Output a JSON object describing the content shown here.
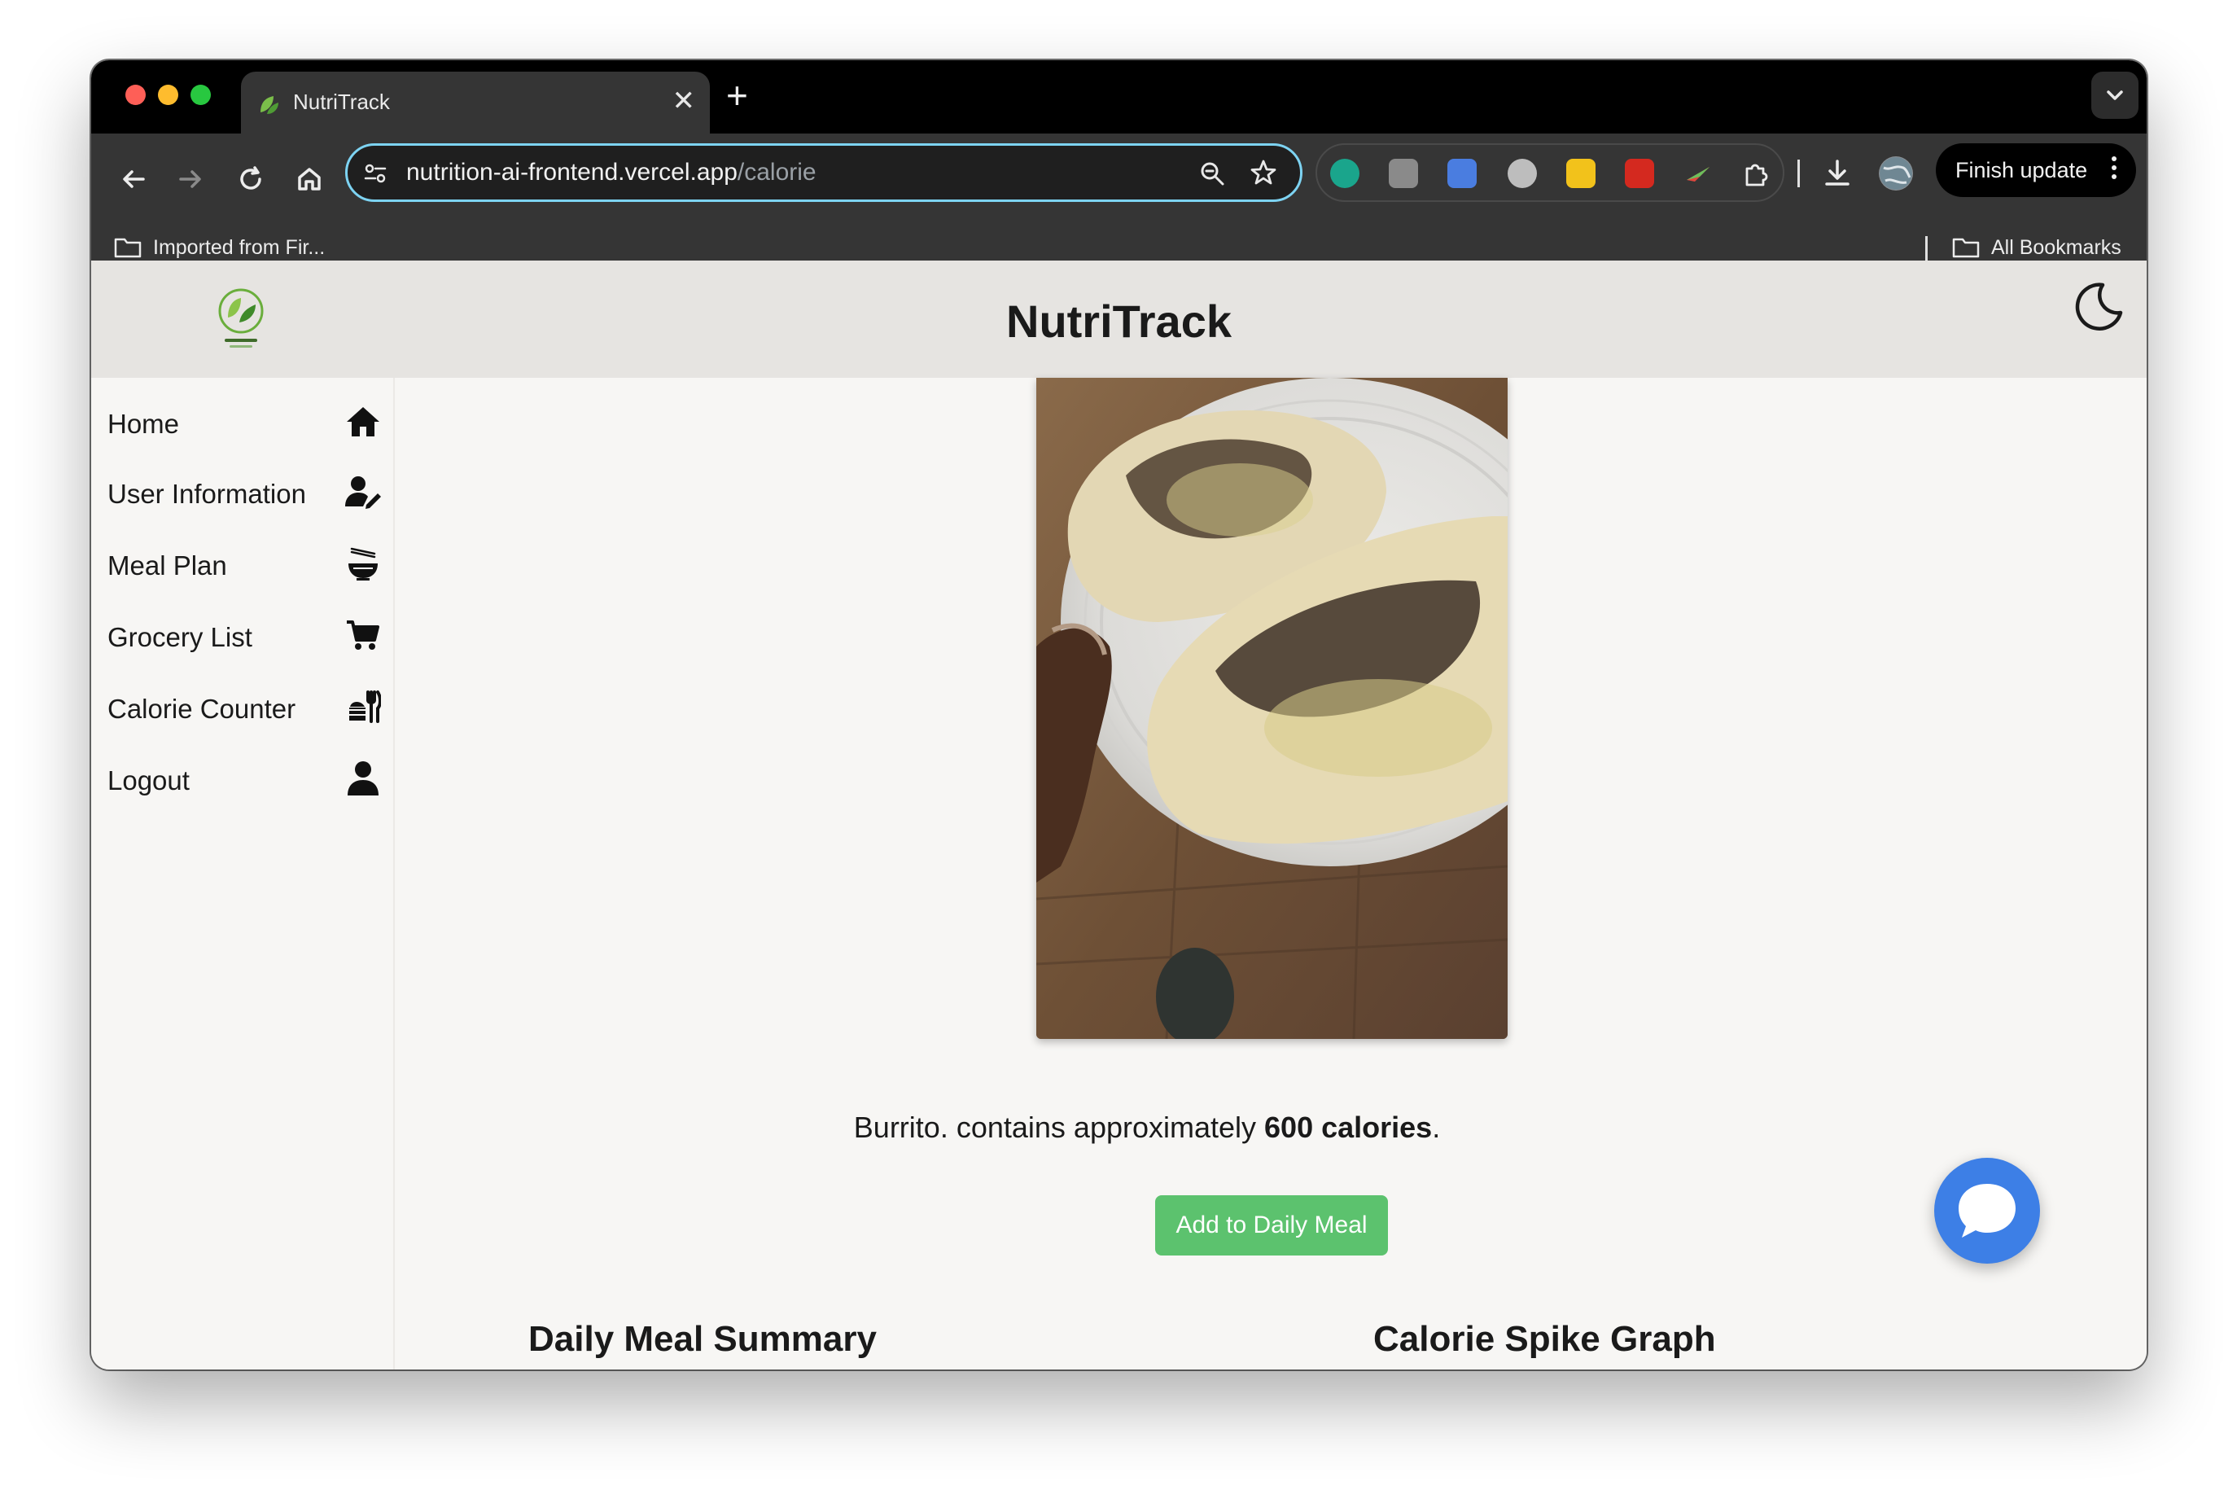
{
  "browser": {
    "tab_title": "NutriTrack",
    "tab_close": "✕",
    "new_tab": "+",
    "url_host": "nutrition-ai-frontend.vercel.app",
    "url_path": "/calorie",
    "finish_update_label": "Finish update",
    "bookmarks": {
      "imported": "Imported from Fir...",
      "all_bookmarks": "All Bookmarks"
    }
  },
  "app": {
    "title": "NutriTrack",
    "sidebar": {
      "items": [
        {
          "label": "Home",
          "icon": "home-icon"
        },
        {
          "label": "User Information",
          "icon": "user-edit-icon"
        },
        {
          "label": "Meal Plan",
          "icon": "noodle-bowl-icon"
        },
        {
          "label": "Grocery List",
          "icon": "shopping-cart-icon"
        },
        {
          "label": "Calorie Counter",
          "icon": "utensils-fork-icon"
        },
        {
          "label": "Logout",
          "icon": "user-icon"
        }
      ]
    },
    "main": {
      "result": {
        "food": "Burrito.",
        "middle": " contains approximately ",
        "calories": "600 calories",
        "end": "."
      },
      "add_button": "Add to Daily Meal",
      "daily_summary_title": "Daily Meal Summary",
      "spike_graph_title": "Calorie Spike Graph"
    }
  },
  "colors": {
    "accent_green": "#5cc26e",
    "chat_blue": "#3d7fe6",
    "omnibox_focus": "#7dd3f2"
  }
}
